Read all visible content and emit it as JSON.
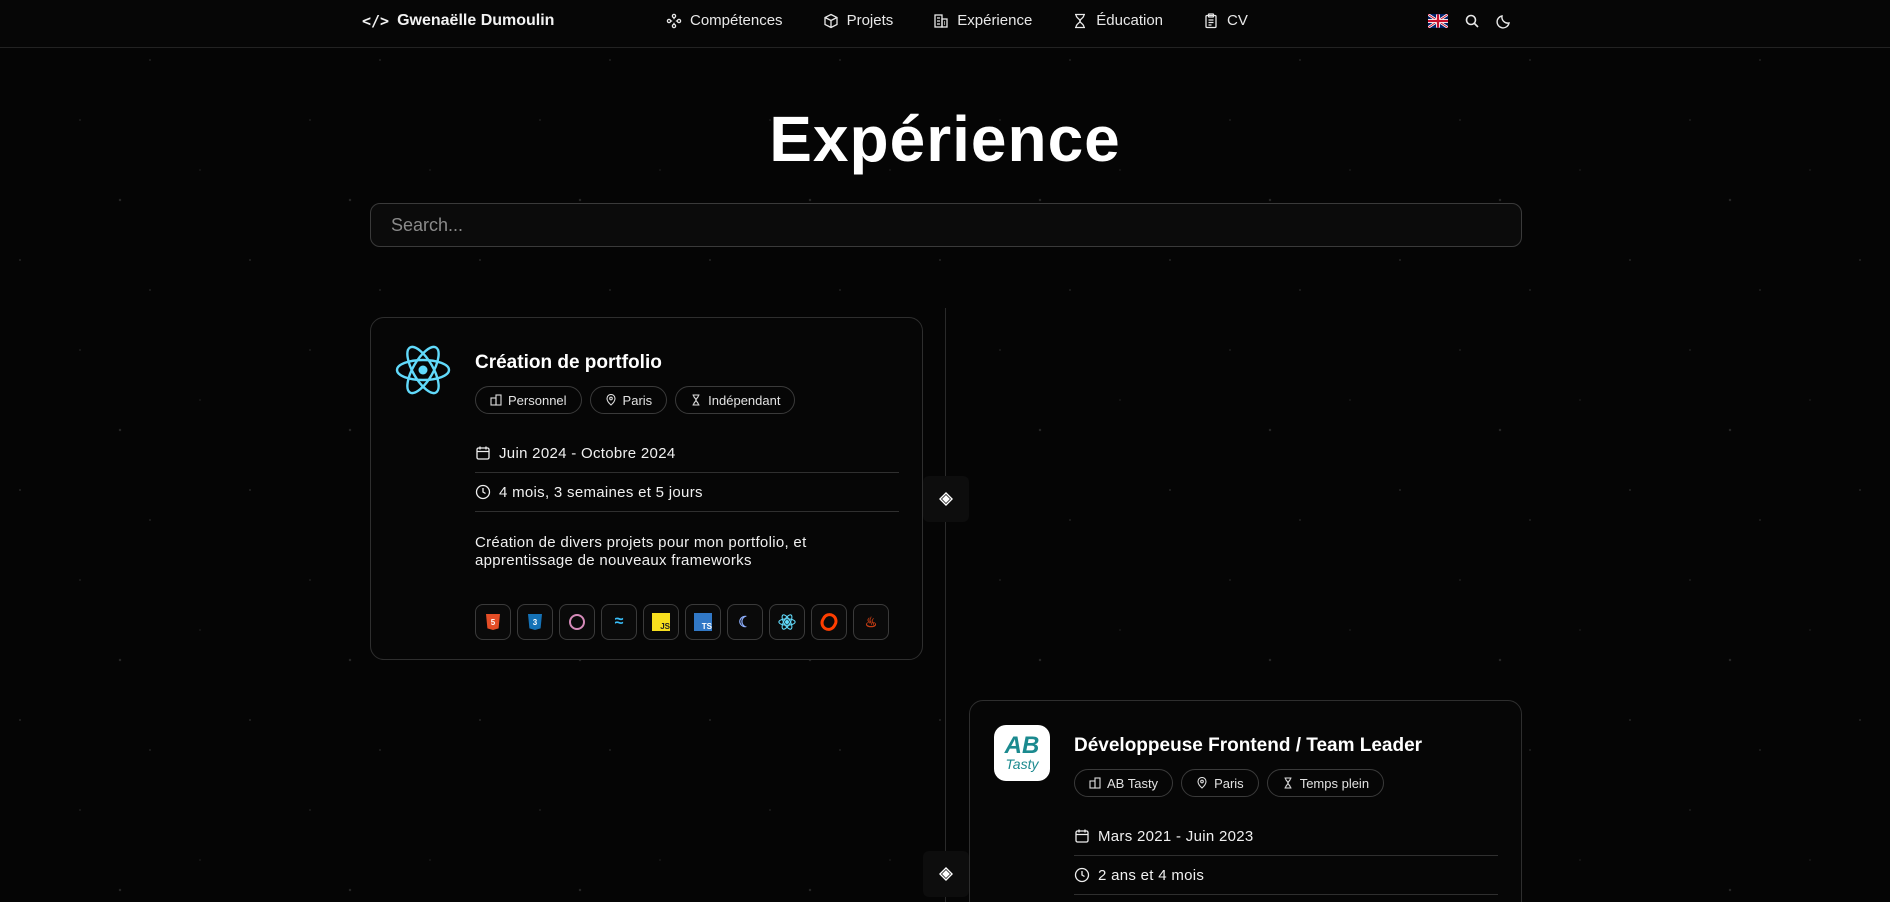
{
  "navbar": {
    "brand": "Gwenaëlle Dumoulin",
    "brand_icon": "</>",
    "links": [
      {
        "label": "Compétences",
        "icon": "skills-icon"
      },
      {
        "label": "Projets",
        "icon": "box-icon"
      },
      {
        "label": "Expérience",
        "icon": "building-icon"
      },
      {
        "label": "Éducation",
        "icon": "hourglass-icon"
      },
      {
        "label": "CV",
        "icon": "clipboard-icon"
      }
    ],
    "right_icons": [
      "uk-flag-icon",
      "search-icon",
      "moon-icon"
    ]
  },
  "page": {
    "title": "Expérience",
    "search_placeholder": "Search..."
  },
  "experiences": [
    {
      "title": "Création de portfolio",
      "logo": "react-logo",
      "tags": [
        "Personnel",
        "Paris",
        "Indépendant"
      ],
      "dates": "Juin 2024 - Octobre 2024",
      "duration": "4 mois, 3 semaines et 5 jours",
      "description": "Création de divers projets pour mon portfolio, et apprentissage de nouveaux frameworks",
      "techs": [
        "html5",
        "css3",
        "redux",
        "tailwind",
        "javascript",
        "typescript",
        "styled-components",
        "react",
        "svelte",
        "jest"
      ]
    },
    {
      "title": "Développeuse Frontend / Team Leader",
      "logo": "ab-tasty-logo",
      "logo_text_top": "AB",
      "logo_text_bottom": "Tasty",
      "tags": [
        "AB Tasty",
        "Paris",
        "Temps plein"
      ],
      "dates": "Mars 2021 - Juin 2023",
      "duration": "2 ans et 4 mois"
    }
  ],
  "colors": {
    "background": "#050505",
    "react": "#61dafb",
    "ab_tasty": "#1b8a8f"
  }
}
